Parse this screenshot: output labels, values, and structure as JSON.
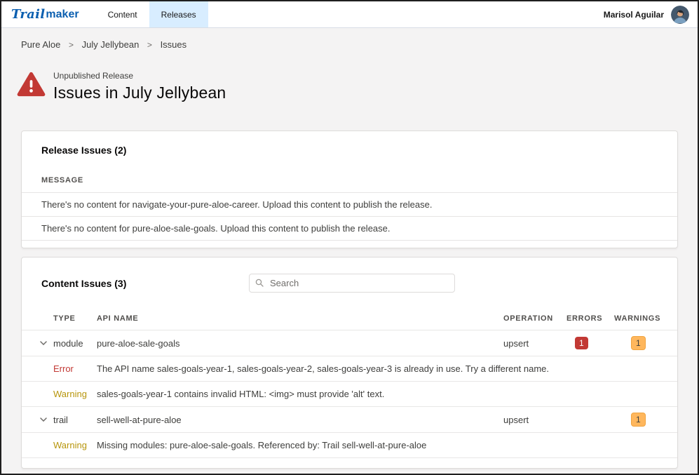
{
  "header": {
    "logo_part1": "Trail",
    "logo_part2": "maker",
    "nav": [
      {
        "label": "Content",
        "active": false
      },
      {
        "label": "Releases",
        "active": true
      }
    ],
    "user_name": "Marisol Aguilar"
  },
  "breadcrumb": {
    "items": [
      "Pure Aloe",
      "July Jellybean",
      "Issues"
    ],
    "separator": ">"
  },
  "page": {
    "eyebrow": "Unpublished Release",
    "title": "Issues in July Jellybean"
  },
  "release_issues": {
    "title": "Release Issues (2)",
    "message_header": "MESSAGE",
    "rows": [
      "There's no content for navigate-your-pure-aloe-career. Upload this content to publish the release.",
      "There's no content for pure-aloe-sale-goals. Upload this content to publish the release."
    ]
  },
  "content_issues": {
    "title": "Content Issues (3)",
    "search_placeholder": "Search",
    "columns": [
      "TYPE",
      "API NAME",
      "OPERATION",
      "ERRORS",
      "WARNINGS"
    ],
    "rows": [
      {
        "type": "module",
        "api_name": "pure-aloe-sale-goals",
        "operation": "upsert",
        "errors": "1",
        "warnings": "1",
        "details": [
          {
            "kind": "Error",
            "message": "The API name sales-goals-year-1, sales-goals-year-2, sales-goals-year-3 is already in use. Try a different name."
          },
          {
            "kind": "Warning",
            "message": "sales-goals-year-1 contains invalid HTML: <img> must provide 'alt' text."
          }
        ]
      },
      {
        "type": "trail",
        "api_name": "sell-well-at-pure-aloe",
        "operation": "upsert",
        "warnings": "1",
        "details": [
          {
            "kind": "Warning",
            "message": "Missing modules: pure-aloe-sale-goals. Referenced by: Trail sell-well-at-pure-aloe"
          }
        ]
      }
    ]
  },
  "colors": {
    "brand_blue": "#0b5fb0",
    "active_tab_bg": "#d8edff",
    "error_red": "#c23934",
    "warning_amber": "#ffb75d",
    "page_bg": "#f4f3f3"
  }
}
